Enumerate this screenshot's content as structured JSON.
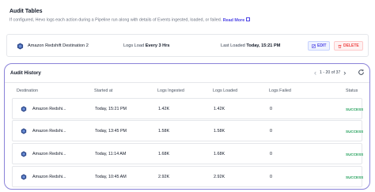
{
  "audit_tables": {
    "title": "Audit Tables",
    "description": "If configured, Hevo logs each action during a Pipeline run along with details of Events ingested, loaded, or failed.",
    "read_more": "Read More"
  },
  "destination_card": {
    "name": "Amazon Redshift Destination 2",
    "logs_load_label": "Logs Load",
    "logs_load_value": "Every 3 Hrs",
    "last_loaded_label": "Last Loaded",
    "last_loaded_value": "Today, 15:21 PM",
    "edit_label": "EDIT",
    "delete_label": "DELETE"
  },
  "audit_history": {
    "title": "Audit History",
    "pagination": "1 - 20 of 37",
    "columns": [
      "Destination",
      "Started at",
      "Logs Ingested",
      "Logs Loaded",
      "Logs Failed",
      "Status"
    ],
    "rows": [
      {
        "destination": "Amazon Redshi...",
        "started_at": "Today, 15:21 PM",
        "logs_ingested": "1.42K",
        "logs_loaded": "1.42K",
        "logs_failed": "0",
        "status": "SUCCESS"
      },
      {
        "destination": "Amazon Redshi...",
        "started_at": "Today, 13:45 PM",
        "logs_ingested": "1.58K",
        "logs_loaded": "1.58K",
        "logs_failed": "0",
        "status": "SUCCESS"
      },
      {
        "destination": "Amazon Redshi...",
        "started_at": "Today, 11:14 AM",
        "logs_ingested": "1.68K",
        "logs_loaded": "1.68K",
        "logs_failed": "0",
        "status": "SUCCESS"
      },
      {
        "destination": "Amazon Redshi...",
        "started_at": "Today, 10:45 AM",
        "logs_ingested": "2.92K",
        "logs_loaded": "2.92K",
        "logs_failed": "0",
        "status": "SUCCESS"
      }
    ]
  },
  "colors": {
    "accent": "#4f46e5",
    "highlight_border": "#8b83d8",
    "success": "#22a05a",
    "danger": "#ef4444",
    "redshift_icon": "#2f4a8c"
  },
  "icons": {
    "destination": "amazon-redshift-icon",
    "edit": "pencil-icon",
    "delete": "trash-icon",
    "external": "external-link-icon",
    "prev": "chevron-left-icon",
    "next": "chevron-right-icon",
    "refresh": "refresh-icon"
  }
}
